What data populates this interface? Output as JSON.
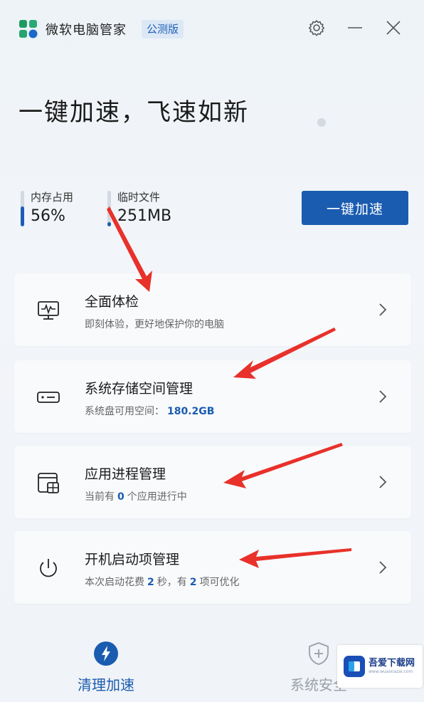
{
  "window": {
    "title": "微软电脑管家",
    "badge": "公测版",
    "icons": [
      "settings-gear-icon",
      "minimize-icon",
      "close-icon"
    ]
  },
  "headline": "一键加速，飞速如新",
  "stats": {
    "memory": {
      "label": "内存占用",
      "value": "56%",
      "fraction": 0.56
    },
    "temp_files": {
      "label": "临时文件",
      "value": "251MB",
      "fraction": 0.12
    }
  },
  "boost_button": "一键加速",
  "cards": [
    {
      "title": "全面体检",
      "subtitle": "即刻体验，更好地保护你的电脑",
      "icon": "monitor-pulse-icon"
    },
    {
      "title": "系统存储空间管理",
      "subtitle_prefix": "系统盘可用空间：",
      "subtitle_value": "180.2GB",
      "icon": "storage-drive-icon"
    },
    {
      "title": "应用进程管理",
      "subtitle_prefix": "当前有",
      "subtitle_value": "0",
      "subtitle_suffix": "个应用进行中",
      "icon": "app-process-icon"
    },
    {
      "title": "开机启动项管理",
      "subtitle_prefix": "本次启动花费",
      "subtitle_value": "2",
      "subtitle_mid": "秒，有",
      "subtitle_value2": "2",
      "subtitle_suffix": "项可优化",
      "icon": "power-icon"
    }
  ],
  "bottom_nav": [
    {
      "label": "清理加速",
      "icon": "lightning-icon",
      "active": true
    },
    {
      "label": "系统安全",
      "icon": "shield-plus-icon",
      "active": false
    }
  ],
  "watermark": {
    "text": "吾爱下载网",
    "sub": "www.wuaixiazai.com"
  },
  "colors": {
    "accent": "#1a5cb0",
    "background": "#f0f3f7",
    "annotation_arrow": "#e8312a"
  }
}
